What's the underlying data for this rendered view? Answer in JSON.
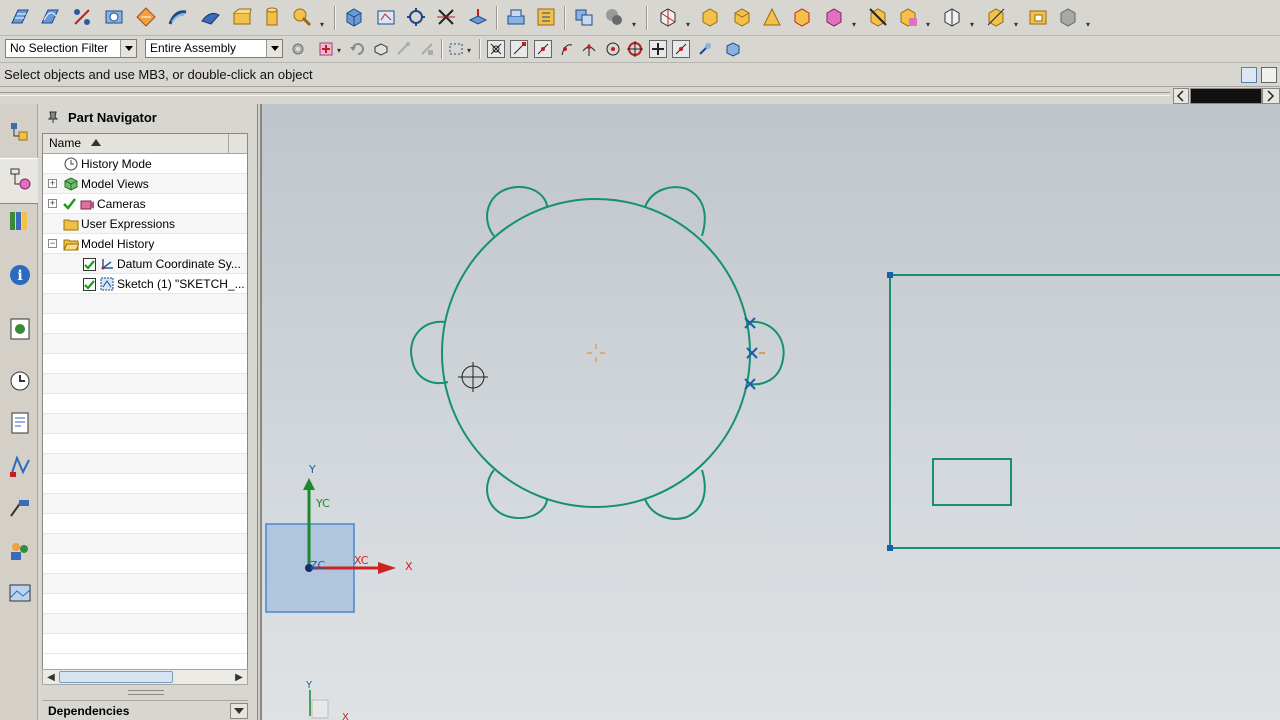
{
  "toolbar": {
    "icons": [
      "sketch-icon",
      "sketch-curve-icon",
      "spline-icon",
      "view-icon",
      "feature-icon",
      "sweep-icon",
      "edit-icon",
      "block-icon",
      "cylinder-icon",
      "assembly-icon",
      "box-view-icon",
      "isometric-view-icon",
      "measure-icon",
      "trim-icon",
      "extend-icon",
      "offset-icon",
      "pattern-icon",
      "layer-icon",
      "display-icon",
      "orient-view-icon",
      "fit-icon",
      "zoom-icon",
      "pan-icon",
      "rotate-icon",
      "shade-icon",
      "wireframe-icon",
      "hide-icon",
      "show-icon",
      "blank-icon",
      "section-icon",
      "render-icon"
    ]
  },
  "filters": {
    "selection_filter": "No Selection Filter",
    "scope": "Entire Assembly"
  },
  "prompt": {
    "text": "Select objects and use MB3, or double-click an object"
  },
  "navigator": {
    "title": "Part Navigator",
    "column_header": "Name",
    "rows": [
      {
        "label": "History Mode",
        "icon": "clock-icon"
      },
      {
        "label": "Model Views",
        "icon": "model-views-icon"
      },
      {
        "label": "Cameras",
        "icon": "camera-icon"
      },
      {
        "label": "User Expressions",
        "icon": "folder-icon"
      },
      {
        "label": "Model History",
        "icon": "folder-open-icon"
      },
      {
        "label": "Datum Coordinate Sy...",
        "icon": "datum-csys-icon"
      },
      {
        "label": "Sketch (1) \"SKETCH_...",
        "icon": "sketch-icon"
      }
    ],
    "dependencies_label": "Dependencies"
  },
  "graphics": {
    "axis_y": "Y",
    "axis_yc": "YC",
    "axis_x": "X",
    "axis_xc": "XC",
    "axis_zc": "ZC",
    "mini_y": "Y",
    "mini_x": "X",
    "sketch_color": "#159070",
    "accent_blue": "#1a5fa8",
    "x_axis_color": "#cc2222",
    "y_axis_color": "#1a8a2a"
  }
}
